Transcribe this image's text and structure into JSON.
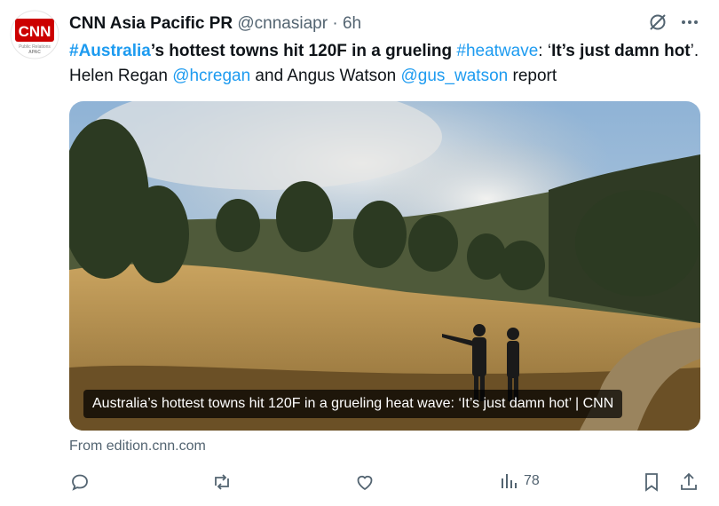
{
  "author": {
    "name": "CNN Asia Pacific PR",
    "handle": "@cnnasiapr",
    "separator": "·",
    "time": "6h",
    "avatar": {
      "logo": "CNN",
      "line1": "Public Relations",
      "line2": "APAC"
    }
  },
  "tweet": {
    "hashtag1": "#Australia",
    "text1": "’s hottest towns hit 120F in a grueling ",
    "hashtag2": "#heatwave",
    "text2": ": ‘",
    "bold_quote": "It’s just damn hot",
    "text3": "’. Helen Regan ",
    "mention1": "@hcregan",
    "text4": " and Angus Watson ",
    "mention2": "@gus_watson",
    "text5": " report"
  },
  "card": {
    "caption": "Australia’s hottest towns hit 120F in a grueling heat wave: ‘It’s just damn hot’ | CNN",
    "source": "From edition.cnn.com"
  },
  "actions": {
    "reply_icon": "reply-icon",
    "repost_icon": "repost-icon",
    "like_icon": "like-icon",
    "views_icon": "views-icon",
    "views_count": "78",
    "bookmark_icon": "bookmark-icon",
    "share_icon": "share-icon"
  },
  "colors": {
    "link": "#1d9bf0",
    "muted": "#536471",
    "cnn_red": "#cc0000"
  }
}
